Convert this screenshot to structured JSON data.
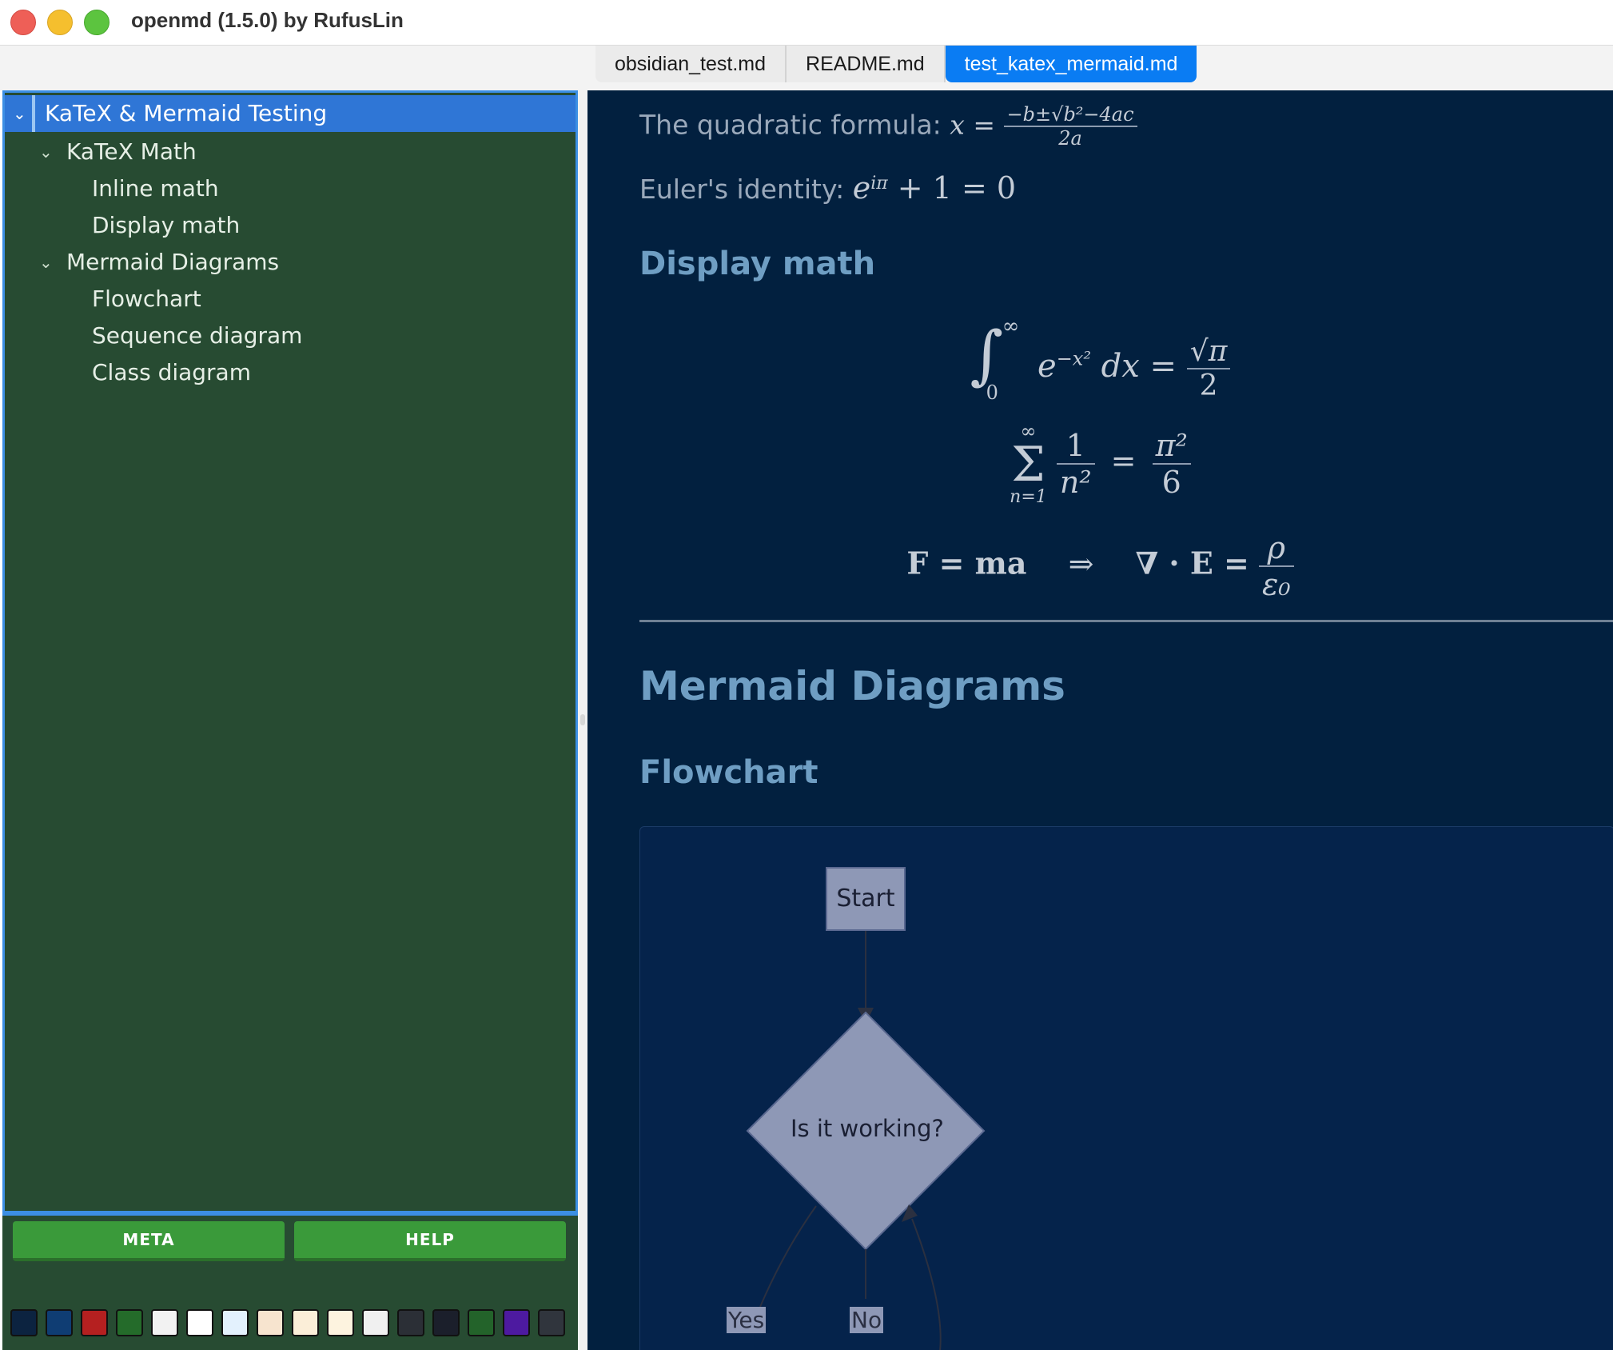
{
  "window": {
    "title": "openmd (1.5.0) by RufusLin"
  },
  "tabs": [
    {
      "label": "obsidian_test.md",
      "active": false
    },
    {
      "label": "README.md",
      "active": false
    },
    {
      "label": "test_katex_mermaid.md",
      "active": true
    }
  ],
  "outline": {
    "items": [
      {
        "label": "KaTeX & Mermaid Testing",
        "level": 0,
        "expanded": true,
        "selected": true
      },
      {
        "label": "KaTeX Math",
        "level": 1,
        "expanded": true
      },
      {
        "label": "Inline math",
        "level": 2
      },
      {
        "label": "Display math",
        "level": 2
      },
      {
        "label": "Mermaid Diagrams",
        "level": 1,
        "expanded": true
      },
      {
        "label": "Flowchart",
        "level": 2
      },
      {
        "label": "Sequence diagram",
        "level": 2
      },
      {
        "label": "Class diagram",
        "level": 2
      }
    ]
  },
  "buttons": {
    "meta": "META",
    "help": "HELP"
  },
  "swatches": [
    "#0c2340",
    "#0f3d73",
    "#b52020",
    "#246b2a",
    "#f2f2f2",
    "#ffffff",
    "#e3f1fd",
    "#f7e4cf",
    "#fbeed8",
    "#fdf3df",
    "#f0f0f0",
    "#2b2f36",
    "#1b1f2b",
    "#23632a",
    "#4d1aa0",
    "#30353d"
  ],
  "document": {
    "quadratic_prefix": "The quadratic formula: ",
    "quadratic_lhs": "x =",
    "quadratic_num": "−b±√b²−4ac",
    "quadratic_den": "2a",
    "euler_prefix": "Euler's identity: ",
    "euler_expr": "e",
    "euler_sup": "iπ",
    "euler_rest": " + 1 = 0",
    "display_math_heading": "Display math",
    "integral_upper": "∞",
    "integral_lower": "0",
    "integral_body": "e",
    "integral_sup": "−x²",
    "integral_dx": " dx =",
    "integral_num": "√π",
    "integral_den": "2",
    "sum_upper": "∞",
    "sum_lower": "n=1",
    "sum_num": "1",
    "sum_den": "n²",
    "sum_eq": "=",
    "sum_rnum": "π²",
    "sum_rden": "6",
    "maxwell_left": "F = ma",
    "maxwell_arrow": "⇒",
    "maxwell_mid": "∇ · E =",
    "maxwell_num": "ρ",
    "maxwell_den": "ε₀",
    "mermaid_heading": "Mermaid Diagrams",
    "flowchart_heading": "Flowchart"
  },
  "flowchart": {
    "start": "Start",
    "decision": "Is it working?",
    "yes": "Yes",
    "no": "No"
  }
}
